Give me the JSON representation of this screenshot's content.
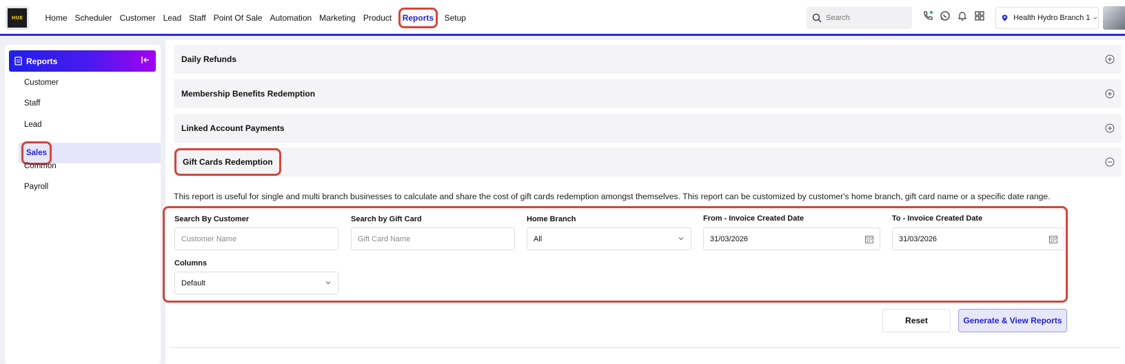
{
  "app": {
    "logo_text": "HUE",
    "nav": [
      "Home",
      "Scheduler",
      "Customer",
      "Lead",
      "Staff",
      "Point Of Sale",
      "Automation",
      "Marketing",
      "Product",
      "Reports",
      "Setup"
    ],
    "active_nav": "Reports",
    "search_placeholder": "Search",
    "branch": "Health Hydro Branch 1",
    "accent_color": "#2323d9",
    "highlight_color": "#d8443a"
  },
  "sidebar": {
    "title": "Reports",
    "items": [
      "Customer",
      "Staff",
      "Lead",
      "Sales",
      "Common",
      "Payroll"
    ],
    "selected": "Sales"
  },
  "accordions": [
    {
      "title": "Daily Refunds",
      "expanded": false
    },
    {
      "title": "Membership Benefits Redemption",
      "expanded": false
    },
    {
      "title": "Linked Account Payments",
      "expanded": false
    },
    {
      "title": "Gift Cards Redemption",
      "expanded": true
    }
  ],
  "report": {
    "description": "This report is useful for single and multi branch businesses to calculate and share the cost of gift cards redemption amongst themselves. This report can be customized by customer's home branch, gift card name or a specific date range.",
    "filters": {
      "customer": {
        "label": "Search By Customer",
        "placeholder": "Customer Name"
      },
      "gift_card": {
        "label": "Search by Gift Card",
        "placeholder": "Gift Card Name"
      },
      "home_branch": {
        "label": "Home Branch",
        "value": "All"
      },
      "from_date": {
        "label": "From - Invoice Created Date",
        "value": "31/03/2026"
      },
      "to_date": {
        "label": "To - Invoice Created Date",
        "value": "31/03/2026"
      },
      "columns": {
        "label": "Columns",
        "value": "Default"
      }
    },
    "reset_label": "Reset",
    "generate_label": "Generate & View Reports"
  }
}
